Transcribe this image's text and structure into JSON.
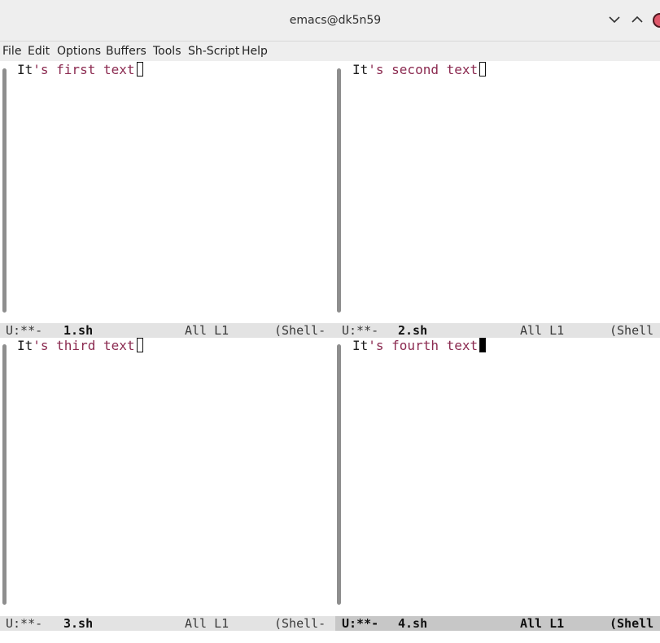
{
  "window": {
    "title": "emacs@dk5n59",
    "controls": {
      "minimize": "chevron-down-icon",
      "maximize": "chevron-up-icon",
      "close": "close-icon"
    }
  },
  "menubar": {
    "items": [
      "File",
      "Edit",
      "Options",
      "Buffers",
      "Tools",
      "Sh-Script",
      "Help"
    ]
  },
  "panes": [
    {
      "text_plain": "It",
      "text_kw": "'s first text",
      "modeline": {
        "status": "U:**-",
        "buffer": "1.sh",
        "position": "All L1",
        "mode": "(Shell-"
      }
    },
    {
      "text_plain": "It",
      "text_kw": "'s second text",
      "modeline": {
        "status": "U:**-",
        "buffer": "2.sh",
        "position": "All L1",
        "mode": "(Shell"
      }
    },
    {
      "text_plain": "It",
      "text_kw": "'s third text",
      "modeline": {
        "status": "U:**-",
        "buffer": "3.sh",
        "position": "All L1",
        "mode": "(Shell-"
      }
    },
    {
      "text_plain": "It",
      "text_kw": "'s fourth text",
      "modeline": {
        "status": "U:**-",
        "buffer": "4.sh",
        "position": "All L1",
        "mode": "(Shell"
      }
    }
  ],
  "colors": {
    "keyword": "#8b2a50",
    "modeline_active": "#c7c7c7",
    "modeline_inactive": "#e3e3e3"
  }
}
